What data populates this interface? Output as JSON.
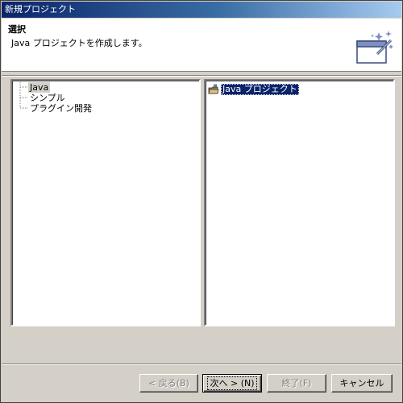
{
  "window": {
    "title": "新規プロジェクト"
  },
  "header": {
    "title": "選択",
    "description": "Java プロジェクトを作成します。",
    "icon": "new-project-wizard-icon"
  },
  "categories": {
    "items": [
      {
        "label": "Java",
        "selected": true
      },
      {
        "label": "シンプル",
        "selected": false
      },
      {
        "label": "プラグイン開発",
        "selected": false
      }
    ]
  },
  "project_types": {
    "items": [
      {
        "label": "Java プロジェクト",
        "icon": "java-project-icon",
        "selected": true
      }
    ]
  },
  "buttons": {
    "back": "< 戻る(B)",
    "next": "次へ > (N)",
    "finish": "終了(F)",
    "cancel": "キャンセル"
  },
  "colors": {
    "selection": "#0a246a",
    "titlebar": "#0a246a",
    "dialog_bg": "#d4d0c8"
  }
}
